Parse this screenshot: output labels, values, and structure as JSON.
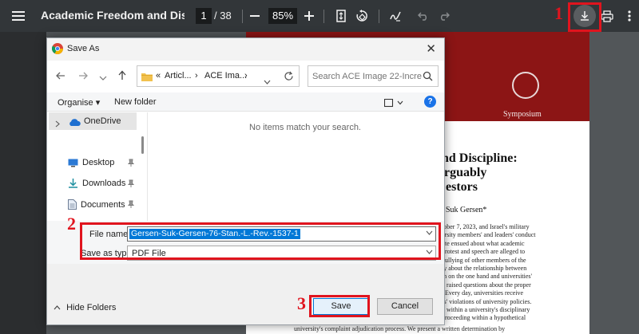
{
  "toolbar": {
    "doc_title": "Academic Freedom and Disciplin...",
    "page_current": "1",
    "page_total": "/ 38",
    "zoom": "85%",
    "menu_icon": "menu-icon",
    "download_icon": "download-icon",
    "print_icon": "print-icon"
  },
  "annotations": {
    "n1": "1",
    "n2": "2",
    "n3": "3",
    "box_color": "#e0141e"
  },
  "background_page": {
    "symposium": "Symposium",
    "title_lines": [
      "nd Discipline:",
      "rguably",
      "estors"
    ],
    "author": "Suk Gersen*",
    "body_lines": [
      "tober 7, 2023, and Israel's military",
      "ersity members' and leaders' conduct",
      "ute ensued about what academic",
      "protest and speech are alleged to",
      "bullying of other members of the",
      "ty about the relationship between",
      "m on the one hand and universities'",
      "o raised questions about the proper",
      ". Every day, universities receive",
      "rs' violations of university policies.",
      "d within a university's disciplinary",
      "proceeding within a hypothetical"
    ],
    "bottom_line": "university's complaint adjudication process. We present a written determination by",
    "header_color": "#8c1515"
  },
  "dialog": {
    "title": "Save As",
    "close": "✕",
    "address_crumbs": [
      "«",
      "Articl...",
      "›",
      "ACE Ima...",
      "›"
    ],
    "search_placeholder": "Search ACE Image 22-Incre...",
    "organise": "Organise ▾",
    "new_folder": "New folder",
    "help": "?",
    "nav_pane": {
      "onedrive": "OneDrive",
      "items": [
        "Desktop",
        "Downloads",
        "Documents"
      ]
    },
    "empty_message": "No items match your search.",
    "file_name_label": "File name:",
    "file_name_value": "Gersen-Suk-Gersen-76-Stan.-L.-Rev.-1537-1",
    "save_as_type_label": "Save as type:",
    "save_as_type_value": "PDF File",
    "hide_folders": "Hide Folders",
    "save": "Save",
    "cancel": "Cancel"
  }
}
